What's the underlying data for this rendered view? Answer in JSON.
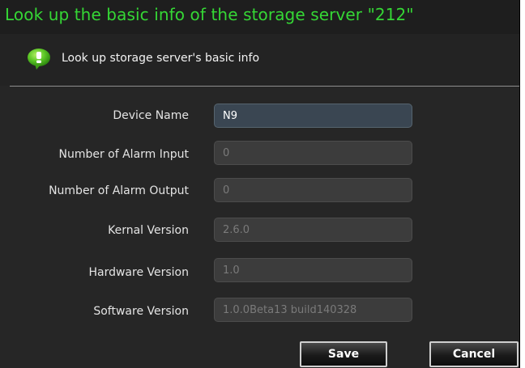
{
  "dialog": {
    "title": "Look up the basic info of the storage server \"212\"",
    "subtitle": "Look up storage server's basic info",
    "icon": "info-bubble-icon",
    "accent_color": "#35d735",
    "background_color": "#262626"
  },
  "fields": {
    "device_name": {
      "label": "Device Name",
      "value": "N9",
      "editable": true
    },
    "alarm_input": {
      "label": "Number of Alarm Input",
      "value": "0",
      "editable": false
    },
    "alarm_output": {
      "label": "Number of Alarm Output",
      "value": "0",
      "editable": false
    },
    "kernal_version": {
      "label": "Kernal Version",
      "value": "2.6.0",
      "editable": false
    },
    "hardware_version": {
      "label": "Hardware Version",
      "value": "1.0",
      "editable": false
    },
    "software_version": {
      "label": "Software Version",
      "value": "1.0.0Beta13 build140328",
      "editable": false
    }
  },
  "buttons": {
    "save_label": "Save",
    "cancel_label": "Cancel"
  }
}
